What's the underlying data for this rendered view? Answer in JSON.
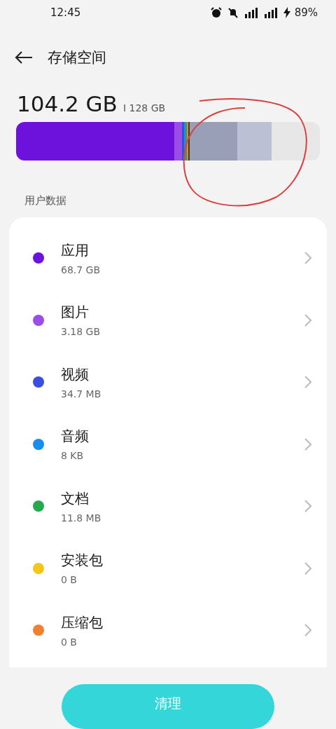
{
  "status_bar": {
    "time": "12:45",
    "battery": "89%"
  },
  "header": {
    "title": "存储空间"
  },
  "summary": {
    "used": "104.2 GB",
    "total": "I 128 GB"
  },
  "storage_bar": {
    "segments": [
      {
        "color": "#6c12dc"
      },
      {
        "color": "#9b4ee6"
      },
      {
        "color": "#3a4ee0"
      },
      {
        "color": "#1a8df0"
      },
      {
        "color": "#26a84e"
      },
      {
        "color": "#f08030"
      },
      {
        "color": "#3a3a3a"
      },
      {
        "color": "#9a9fb8"
      },
      {
        "color": "#bcc0d4"
      }
    ]
  },
  "section_label": "用户数据",
  "items": [
    {
      "name": "应用",
      "size": "68.7 GB",
      "color": "#6c12dc"
    },
    {
      "name": "图片",
      "size": "3.18 GB",
      "color": "#9b4ee6"
    },
    {
      "name": "视频",
      "size": "34.7 MB",
      "color": "#3a4ee0"
    },
    {
      "name": "音频",
      "size": "8 KB",
      "color": "#1a8df0"
    },
    {
      "name": "文档",
      "size": "11.8 MB",
      "color": "#26a84e"
    },
    {
      "name": "安装包",
      "size": "0 B",
      "color": "#f5c518"
    },
    {
      "name": "压缩包",
      "size": "0 B",
      "color": "#f08030"
    }
  ],
  "clean_button": "清理"
}
